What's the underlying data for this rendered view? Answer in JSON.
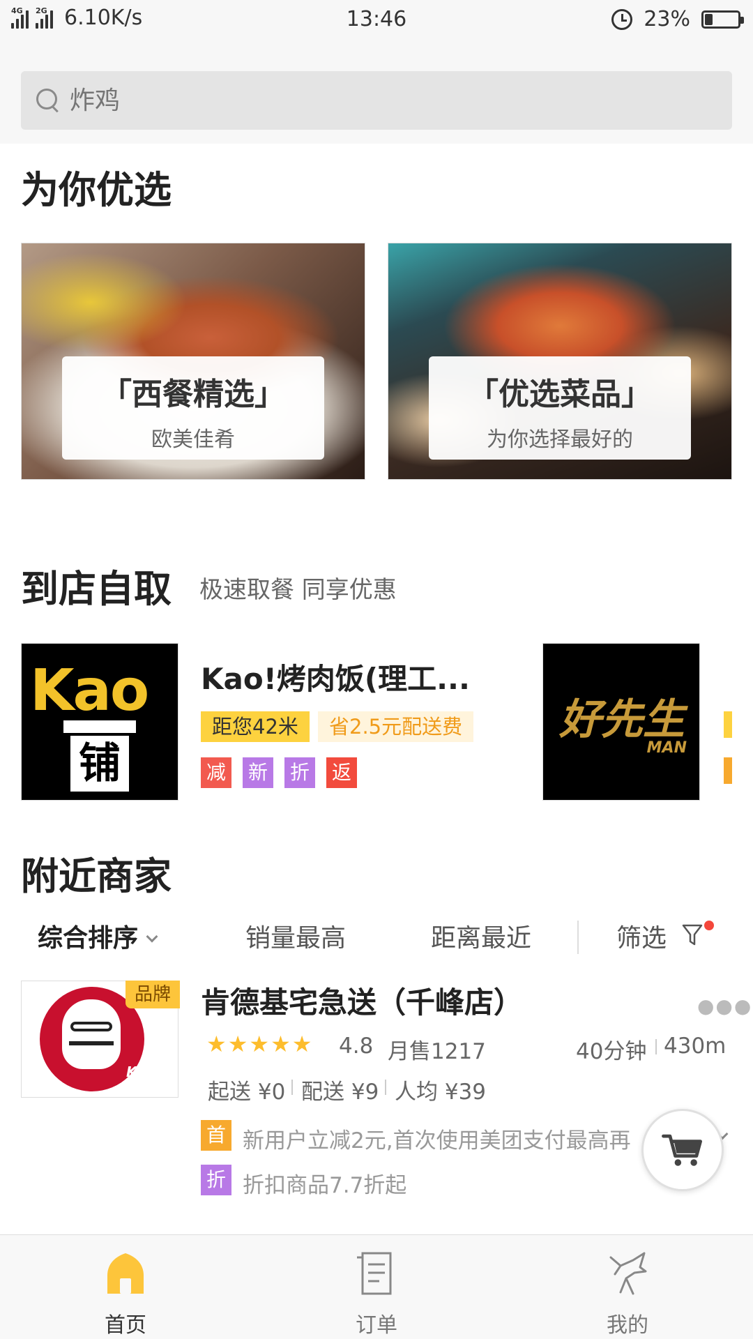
{
  "status_bar": {
    "network_left": "4G",
    "network_left2": "4G",
    "network_right": "2G",
    "speed": "6.10K/s",
    "time": "13:46",
    "battery": "23%",
    "battery_level": 0.23
  },
  "search": {
    "placeholder": "炸鸡"
  },
  "featured": {
    "title": "为你优选",
    "cards": [
      {
        "title": "「西餐精选」",
        "subtitle": "欧美佳肴"
      },
      {
        "title": "「优选菜品」",
        "subtitle": "为你选择最好的"
      }
    ]
  },
  "pickup": {
    "title": "到店自取",
    "subtitle": "极速取餐 同享优惠",
    "stores": [
      {
        "logo_text": "Kao",
        "logo_sub": "铺",
        "name": "Kao!烤肉饭(理工...",
        "distance": "距您42米",
        "saving": "省2.5元配送费",
        "badges": [
          "减",
          "新",
          "折",
          "返"
        ]
      },
      {
        "logo_text": "好先生",
        "logo_sub": "MAN"
      }
    ]
  },
  "nearby": {
    "title": "附近商家",
    "sort": {
      "default": "综合排序",
      "sales": "销量最高",
      "distance": "距离最近",
      "filter": "筛选"
    },
    "merchant": {
      "brand_tag": "品牌",
      "logo_text": "KFC",
      "name": "肯德基宅急送（千峰店）",
      "rating": "4.8",
      "stars": "★★★★★",
      "monthly_sales": "月售1217",
      "eta": "40分钟",
      "distance": "430m",
      "min_order": "起送 ¥0",
      "delivery_fee": "配送 ¥9",
      "per_person": "人均 ¥39",
      "promos": [
        {
          "badge": "首",
          "text": "新用户立减2元,首次使用美团支付最高再",
          "color": "#f7a92e"
        },
        {
          "badge": "折",
          "text": "折扣商品7.7折起",
          "color": "#b879e6"
        }
      ]
    }
  },
  "bottom_nav": [
    {
      "label": "首页",
      "icon": "home-icon",
      "active": true
    },
    {
      "label": "订单",
      "icon": "order-icon",
      "active": false
    },
    {
      "label": "我的",
      "icon": "profile-icon",
      "active": false
    }
  ],
  "colors": {
    "accent_yellow": "#fdc53b",
    "badge_red": "#f25a4f",
    "badge_purple": "#b879e6",
    "star": "#fdbd2d"
  }
}
